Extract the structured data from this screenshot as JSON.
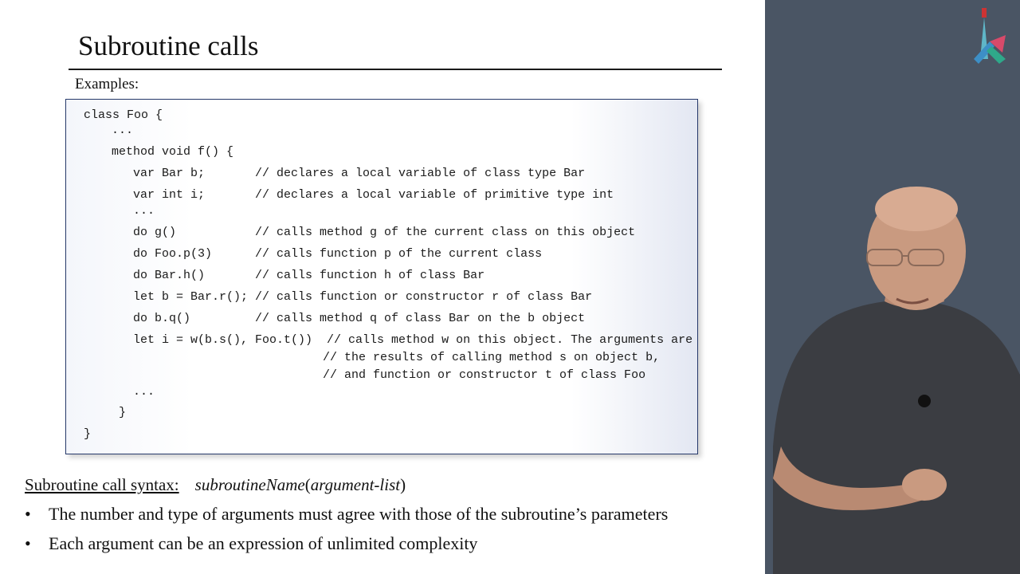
{
  "slide": {
    "title": "Subroutine calls",
    "examples_label": "Examples:",
    "code_lines": [
      "class Foo {",
      "...",
      "method void f() {",
      "var Bar b;       // declares a local variable of class type Bar",
      "var int i;       // declares a local variable of primitive type int",
      "...",
      "do g()           // calls method g of the current class on this object",
      "do Foo.p(3)      // calls function p of the current class",
      "do Bar.h()       // calls function h of class Bar",
      "let b = Bar.r(); // calls function or constructor r of class Bar",
      "do b.q()         // calls method q of class Bar on the b object",
      "let i = w(b.s(), Foo.t())  // calls method w on this object. The arguments are",
      "// the results of calling method s on object b,",
      "// and function or constructor t of class Foo",
      "...",
      "}",
      "}"
    ],
    "syntax_label": "Subroutine call syntax:",
    "syntax_name": "subroutineName",
    "syntax_open": "(",
    "syntax_args": "argument-list",
    "syntax_close": ")",
    "bullet_marker": "•",
    "bullets": [
      "The number and type of arguments must agree with those of the subroutine’s parameters",
      "Each argument can be an expression of unlimited complexity"
    ]
  },
  "colors": {
    "code_border": "#26396a",
    "video_bg": "#4a5564"
  }
}
